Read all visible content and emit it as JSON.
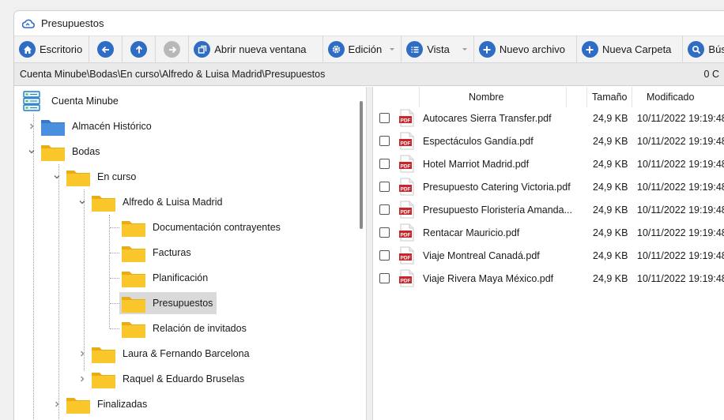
{
  "window": {
    "title": "Presupuestos"
  },
  "toolbar": {
    "escritorio": "Escritorio",
    "abrir_nueva_ventana": "Abrir nueva ventana",
    "edicion": "Edición",
    "vista": "Vista",
    "nuevo_archivo": "Nuevo archivo",
    "nueva_carpeta": "Nueva Carpeta",
    "busqueda": "Búsq"
  },
  "pathbar": {
    "path": "Cuenta Minube\\Bodas\\En curso\\Alfredo & Luisa Madrid\\Presupuestos",
    "count": "0 C"
  },
  "tree": {
    "root": "Cuenta Minube",
    "items": [
      "Almacén Histórico",
      "Bodas",
      "En curso",
      "Alfredo & Luisa Madrid",
      "Documentación contrayentes",
      "Facturas",
      "Planificación",
      "Presupuestos",
      "Relación de invitados",
      "Laura & Fernando Barcelona",
      "Raquel & Eduardo Bruselas",
      "Finalizadas"
    ]
  },
  "files": {
    "headers": {
      "name": "Nombre",
      "size": "Tamaño",
      "modified": "Modificado"
    },
    "icon_label": "PDF",
    "rows": [
      {
        "name": "Autocares Sierra Transfer.pdf",
        "size": "24,9 KB",
        "modified": "10/11/2022 19:19:48"
      },
      {
        "name": "Espectáculos Gandía.pdf",
        "size": "24,9 KB",
        "modified": "10/11/2022 19:19:48"
      },
      {
        "name": "Hotel Marriot Madrid.pdf",
        "size": "24,9 KB",
        "modified": "10/11/2022 19:19:48"
      },
      {
        "name": "Presupuesto Catering Victoria.pdf",
        "size": "24,9 KB",
        "modified": "10/11/2022 19:19:48"
      },
      {
        "name": "Presupuesto Floristería Amanda...",
        "size": "24,9 KB",
        "modified": "10/11/2022 19:19:48"
      },
      {
        "name": "Rentacar Mauricio.pdf",
        "size": "24,9 KB",
        "modified": "10/11/2022 19:19:48"
      },
      {
        "name": "Viaje Montreal Canadá.pdf",
        "size": "24,9 KB",
        "modified": "10/11/2022 19:19:48"
      },
      {
        "name": "Viaje Rivera Maya México.pdf",
        "size": "24,9 KB",
        "modified": "10/11/2022 19:19:48"
      }
    ]
  },
  "colors": {
    "accent": "#2f6cc4",
    "folder": "#f9c62b",
    "folder_blue": "#4a8ee0",
    "pdf_red": "#c8262c"
  }
}
